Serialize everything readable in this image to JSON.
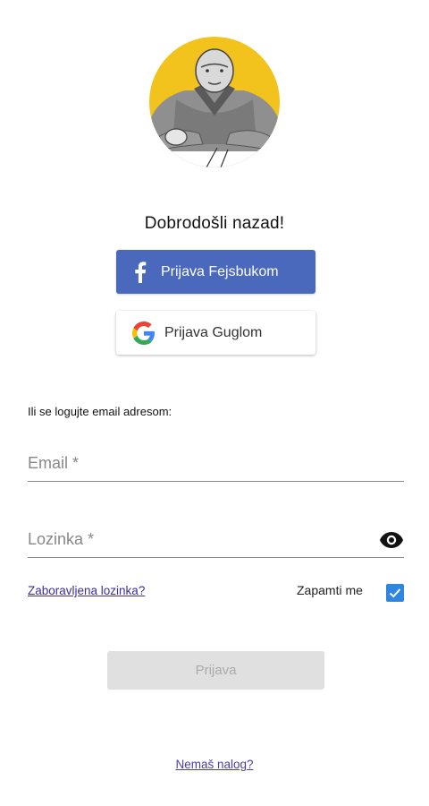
{
  "welcome": "Dobrodošli nazad!",
  "social": {
    "facebook_label": "Prijava Fejsbukom",
    "google_label": "Prijava Guglom"
  },
  "email_hint": "Ili se logujte email adresom:",
  "fields": {
    "email_placeholder": "Email *",
    "password_placeholder": "Lozinka *"
  },
  "forgot_password": "Zaboravljena lozinka?",
  "remember_me": {
    "label": "Zapamti me",
    "checked": true
  },
  "login_button": "Prijava",
  "signup_link": "Nemaš nalog?",
  "colors": {
    "facebook": "#4a69bd",
    "avatar_background": "#f5c518",
    "checkbox": "#2f86e0",
    "link": "#3a2f9c",
    "disabled_button": "#e0e0e0"
  }
}
